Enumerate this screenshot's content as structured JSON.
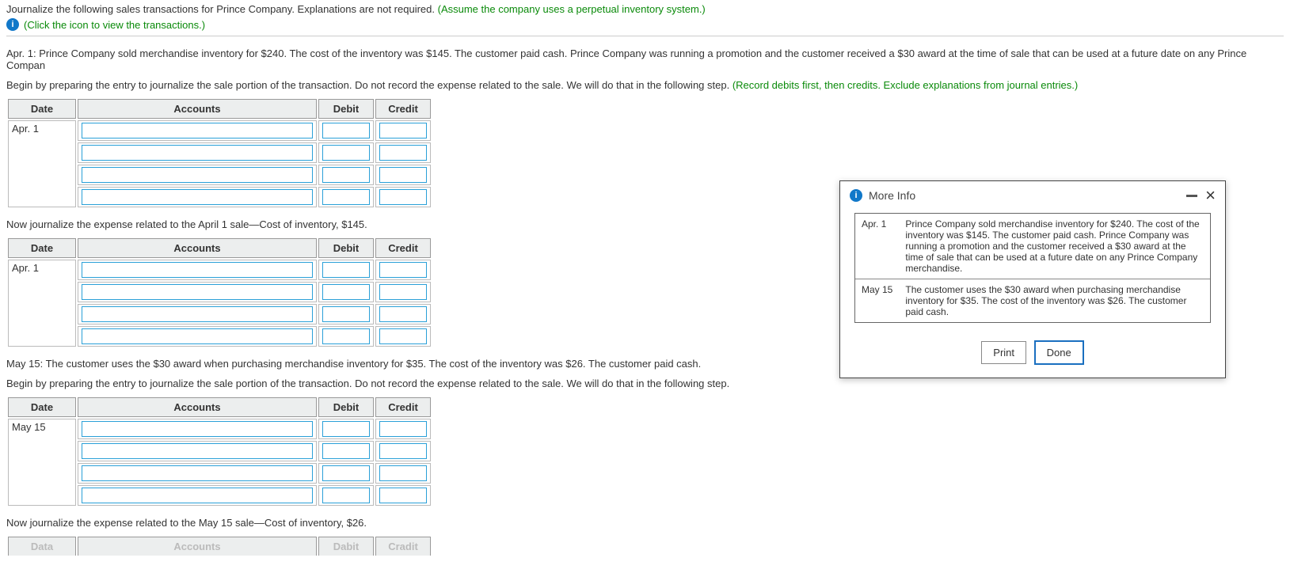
{
  "intro": {
    "prefix": "Journalize the following sales transactions for Prince Company. Explanations are not required. ",
    "green_suffix": "(Assume the company uses a perpetual inventory system.)"
  },
  "click_hint": "(Click the icon to view the transactions.)",
  "apr1_desc": "Apr. 1: Prince Company sold merchandise inventory for $240. The cost of the inventory was $145. The customer paid cash. Prince Company was running a promotion and the customer received a $30 award at the time of sale that can be used at a future date on any Prince Compan",
  "apr1_instr_prefix": "Begin by preparing the entry to journalize the sale portion of the transaction. Do not record the expense related to the sale. We will do that in the following step. ",
  "apr1_instr_green": "(Record debits first, then credits. Exclude explanations from journal entries.)",
  "table_headers": {
    "date": "Date",
    "accounts": "Accounts",
    "debit": "Debit",
    "credit": "Credit"
  },
  "partial_headers": {
    "date": "Data",
    "accounts": "Accounts",
    "debit": "Dabit",
    "credit": "Cradit"
  },
  "dates": {
    "apr1": "Apr. 1",
    "may15": "May 15"
  },
  "apr1_expense_instr": "Now journalize the expense related to the April 1 sale—Cost of inventory, $145.",
  "may15_desc": "May 15: The customer uses the $30 award when purchasing merchandise inventory for $35. The cost of the inventory was $26. The customer paid cash.",
  "may15_instr": "Begin by preparing the entry to journalize the sale portion of the transaction. Do not record the expense related to the sale. We will do that in the following step.",
  "may15_expense_instr": "Now journalize the expense related to the May 15 sale—Cost of inventory, $26.",
  "modal": {
    "title": "More Info",
    "rows": [
      {
        "date": "Apr. 1",
        "text": "Prince Company sold merchandise inventory for $240. The cost of the inventory was $145. The customer paid cash. Prince Company was running a promotion and the customer received a $30 award at the time of sale that can be used at a future date on any Prince Company merchandise."
      },
      {
        "date": "May 15",
        "text": "The customer uses the $30 award when purchasing merchandise inventory for $35. The cost of the inventory was $26. The customer paid cash."
      }
    ],
    "print": "Print",
    "done": "Done"
  }
}
